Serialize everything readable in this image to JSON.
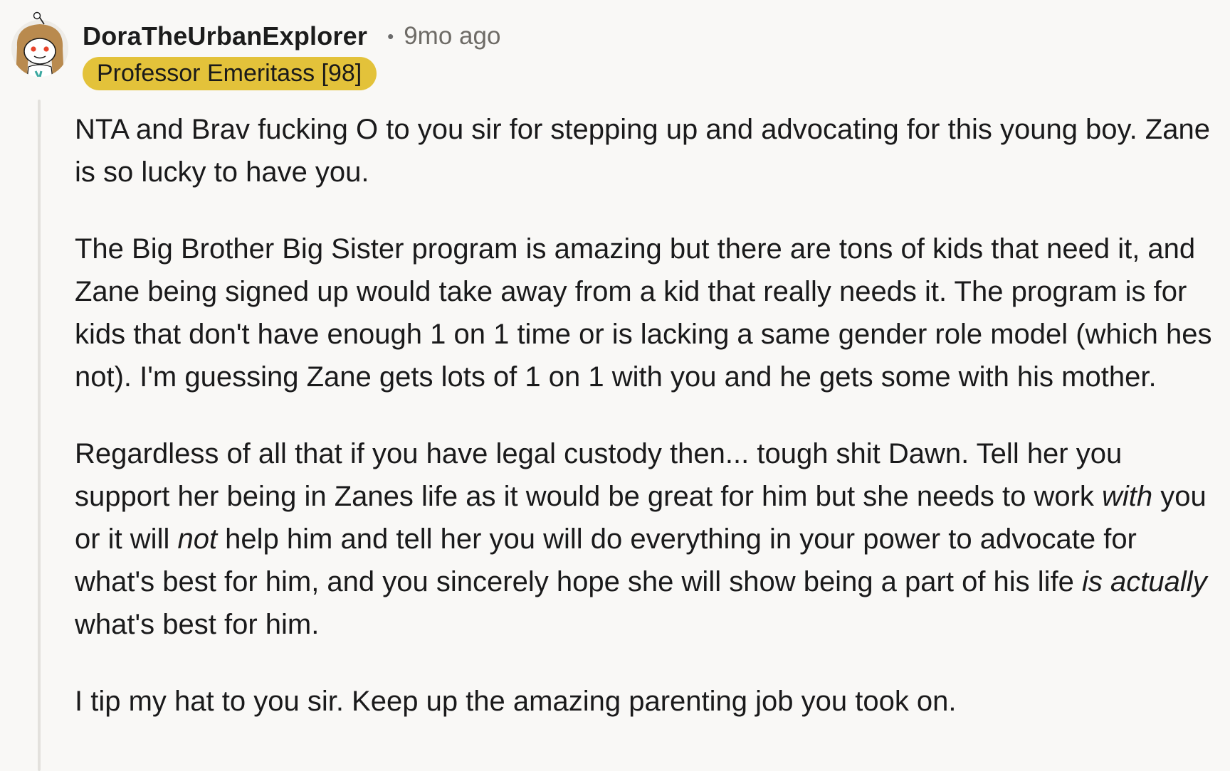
{
  "comment": {
    "username": "DoraTheUrbanExplorer",
    "separator": "•",
    "timestamp": "9mo ago",
    "flair": "Professor Emeritass [98]",
    "avatar_icon": "snoo-avatar-icon",
    "colors": {
      "flair_bg": "#e3c23a",
      "background": "#f9f8f6",
      "thread_line": "#e3e1dd",
      "meta_text": "#6e6b66"
    },
    "paragraphs": {
      "p1": "NTA and Brav fucking O to you sir for stepping up and advocating for this young boy. Zane is so lucky to have you.",
      "p2": "The Big Brother Big Sister program is amazing but there are tons of kids that need it, and Zane being signed up would take away from a kid that really needs it. The program is for kids that don't have enough 1 on 1 time or is lacking a same gender role model (which hes not). I'm guessing Zane gets lots of 1 on 1 with you and he gets some with his mother.",
      "p3": {
        "a": "Regardless of all that if you have legal custody then... tough shit Dawn. Tell her you support her being in Zanes life as it would be great for him but she needs to work ",
        "b": "with",
        "c": " you or it will ",
        "d": "not",
        "e": " help him and tell her you will do everything in your power to advocate for what's best for him, and you sincerely hope she will show being a part of his life ",
        "f": "is actually",
        "g": " what's best for him."
      },
      "p4": "I tip my hat to you sir. Keep up the amazing parenting job you took on."
    }
  }
}
